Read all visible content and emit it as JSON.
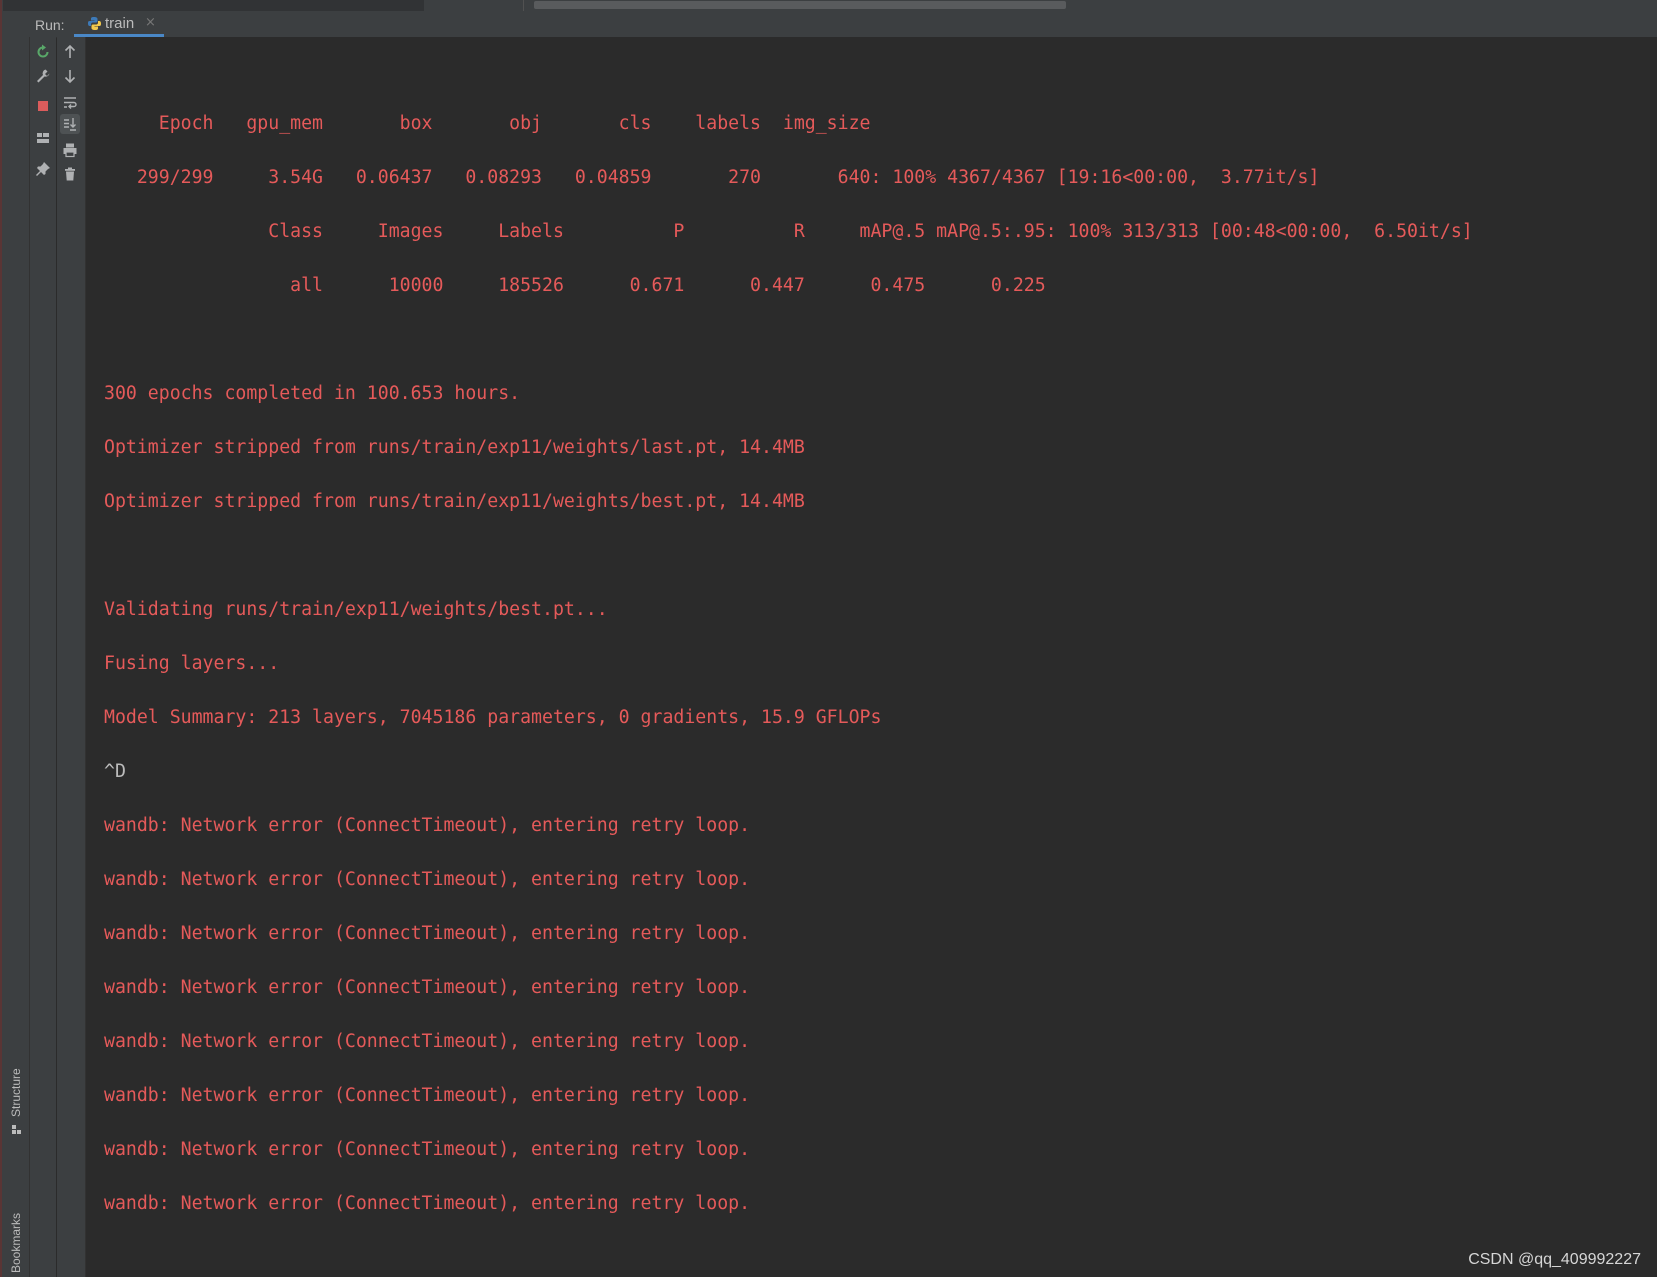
{
  "run_bar": {
    "label": "Run:",
    "tab_label": "train",
    "tab_close": "×"
  },
  "side_tabs": {
    "structure": "Structure",
    "bookmarks": "Bookmarks"
  },
  "console": {
    "lines": [
      "     Epoch   gpu_mem       box       obj       cls    labels  img_size",
      "   299/299     3.54G   0.06437   0.08293   0.04859       270       640: 100% 4367/4367 [19:16<00:00,  3.77it/s]",
      "               Class     Images     Labels          P          R     mAP@.5 mAP@.5:.95: 100% 313/313 [00:48<00:00,  6.50it/s]",
      "                 all      10000     185526      0.671      0.447      0.475      0.225",
      "",
      "300 epochs completed in 100.653 hours.",
      "Optimizer stripped from runs/train/exp11/weights/last.pt, 14.4MB",
      "Optimizer stripped from runs/train/exp11/weights/best.pt, 14.4MB",
      "",
      "Validating runs/train/exp11/weights/best.pt...",
      "Fusing layers...",
      "Model Summary: 213 layers, 7045186 parameters, 0 gradients, 15.9 GFLOPs",
      "^D",
      "wandb: Network error (ConnectTimeout), entering retry loop.",
      "wandb: Network error (ConnectTimeout), entering retry loop.",
      "wandb: Network error (ConnectTimeout), entering retry loop.",
      "wandb: Network error (ConnectTimeout), entering retry loop.",
      "wandb: Network error (ConnectTimeout), entering retry loop.",
      "wandb: Network error (ConnectTimeout), entering retry loop.",
      "wandb: Network error (ConnectTimeout), entering retry loop.",
      "wandb: Network error (ConnectTimeout), entering retry loop."
    ],
    "error_color": "#e55a5a",
    "plain_color": "#bbbbbb"
  },
  "toolbar_icons": {
    "col1": [
      "rerun-icon",
      "wrench-icon",
      "stop-icon",
      "layout-icon",
      "pin-icon"
    ],
    "col2": [
      "arrow-up-icon",
      "arrow-down-icon",
      "soft-wrap-icon",
      "scroll-to-end-icon",
      "print-icon",
      "trash-icon"
    ]
  },
  "watermark": "CSDN @qq_409992227"
}
